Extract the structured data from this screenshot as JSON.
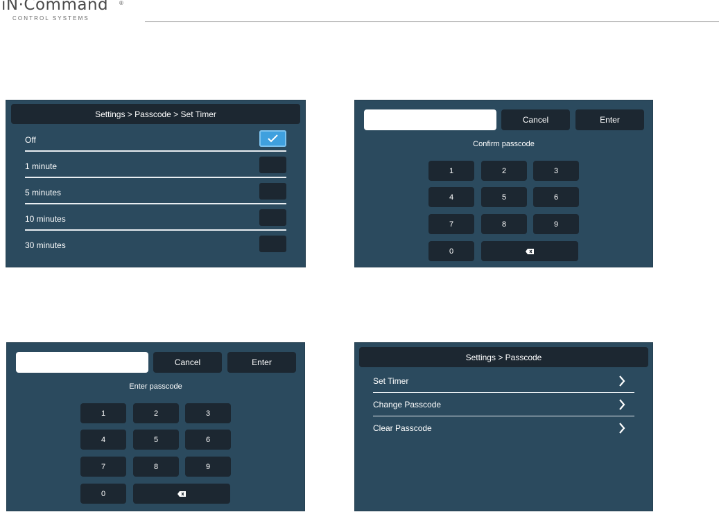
{
  "brand": {
    "name": "iN·Command",
    "reg": "®",
    "tagline": "CONTROL SYSTEMS"
  },
  "timer_screen": {
    "breadcrumb": "Settings > Passcode > Set Timer",
    "options": [
      {
        "label": "Off",
        "selected": true
      },
      {
        "label": "1 minute",
        "selected": false
      },
      {
        "label": "5 minutes",
        "selected": false
      },
      {
        "label": "10 minutes",
        "selected": false
      },
      {
        "label": "30 minutes",
        "selected": false
      }
    ]
  },
  "confirm_screen": {
    "passcode_value": "",
    "cancel": "Cancel",
    "enter": "Enter",
    "prompt": "Confirm passcode",
    "keys": [
      "1",
      "2",
      "3",
      "4",
      "5",
      "6",
      "7",
      "8",
      "9",
      "0"
    ],
    "backspace_icon": "backspace-icon"
  },
  "enter_screen": {
    "passcode_value": "",
    "cancel": "Cancel",
    "enter": "Enter",
    "prompt": "Enter passcode",
    "keys": [
      "1",
      "2",
      "3",
      "4",
      "5",
      "6",
      "7",
      "8",
      "9",
      "0"
    ],
    "backspace_icon": "backspace-icon"
  },
  "passcode_menu": {
    "breadcrumb": "Settings > Passcode",
    "items": [
      {
        "label": "Set Timer",
        "icon": "chevron-right-icon"
      },
      {
        "label": "Change Passcode",
        "icon": "chevron-right-icon"
      },
      {
        "label": "Clear Passcode",
        "icon": "chevron-right-icon"
      }
    ]
  },
  "colors": {
    "panel": "#2b4a5e",
    "control": "#1c2731",
    "accent": "#3fa0de",
    "text": "#ffffff"
  }
}
